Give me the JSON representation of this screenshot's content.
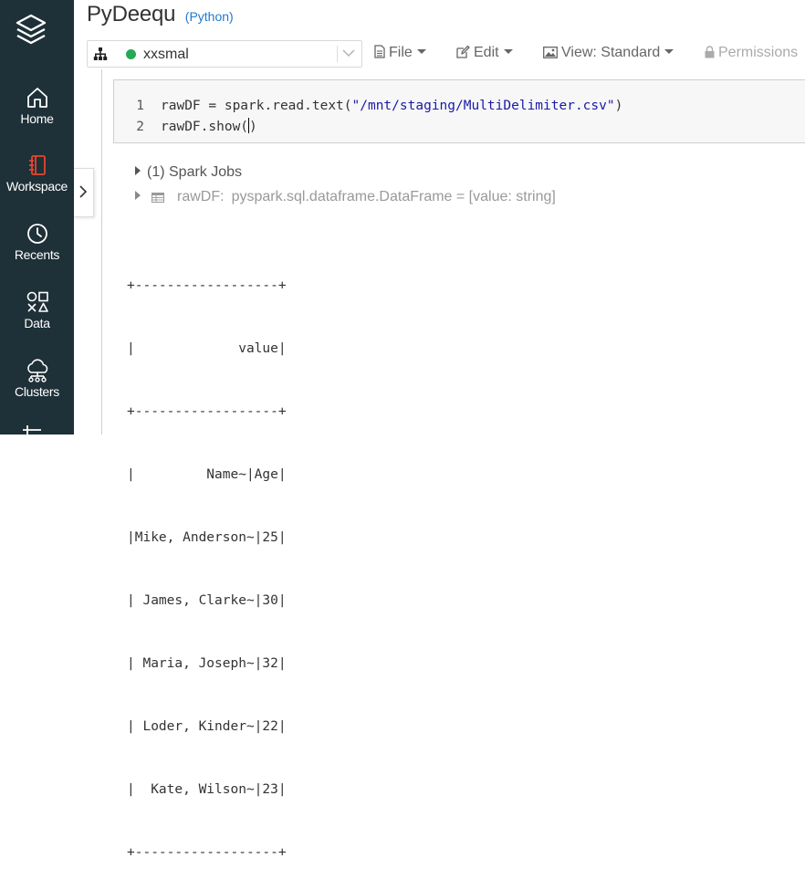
{
  "sidebar": {
    "items": [
      {
        "label": "Home",
        "icon": "home-icon"
      },
      {
        "label": "Workspace",
        "icon": "workspace-icon",
        "active": true
      },
      {
        "label": "Recents",
        "icon": "clock-icon"
      },
      {
        "label": "Data",
        "icon": "data-icon"
      },
      {
        "label": "Clusters",
        "icon": "clusters-icon"
      }
    ],
    "colors": {
      "bg": "#1e3038",
      "active_icon": "#e8442c"
    }
  },
  "notebook": {
    "title": "PyDeequ",
    "language": "(Python)"
  },
  "toolbar": {
    "cluster_name": "xxsmal",
    "cluster_status_color": "#27a857",
    "file_label": "File",
    "edit_label": "Edit",
    "view_label": "View: Standard",
    "permissions_label": "Permissions"
  },
  "cell": {
    "line_numbers": [
      "1",
      "2"
    ],
    "line1_prefix": "rawDF = spark.read.text(",
    "line1_string": "\"/mnt/staging/MultiDelimiter.csv\"",
    "line1_suffix": ")",
    "line2_before_cursor": "rawDF.show(",
    "line2_after_cursor": ")"
  },
  "results": {
    "spark_jobs": "(1) Spark Jobs",
    "df_name": "rawDF:",
    "df_schema": "pyspark.sql.dataframe.DataFrame = [value: string]",
    "output_lines": [
      "+------------------+",
      "|             value|",
      "+------------------+",
      "|         Name~|Age|",
      "|Mike, Anderson~|25|",
      "| James, Clarke~|30|",
      "| Maria, Joseph~|32|",
      "| Loder, Kinder~|22|",
      "|  Kate, Wilson~|23|",
      "+------------------+"
    ]
  }
}
